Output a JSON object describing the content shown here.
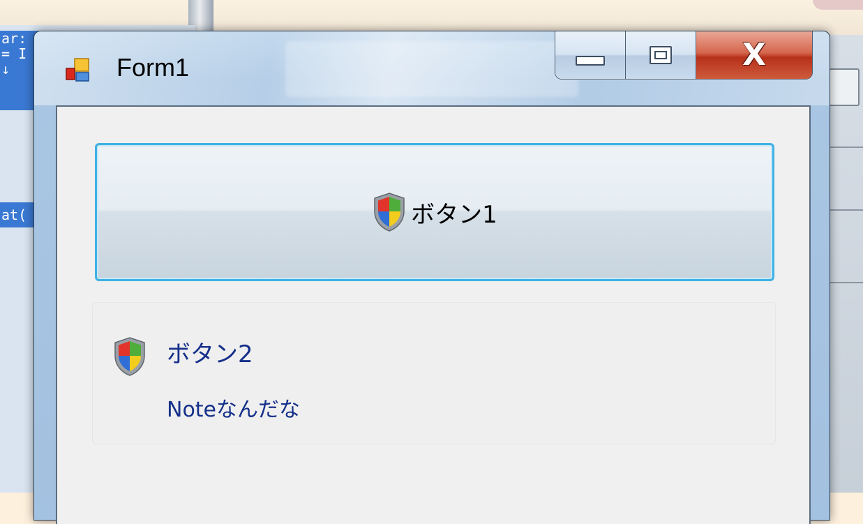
{
  "window": {
    "title": "Form1",
    "app_icon": "form-app-icon",
    "caption_buttons": {
      "minimize": "minimize-icon",
      "maximize": "maximize-icon",
      "close": "close-icon",
      "close_glyph": "X"
    }
  },
  "background": {
    "editor_fragments": [
      "ar:",
      "= I",
      "↓",
      "at("
    ]
  },
  "client": {
    "button1": {
      "label": "ボタン1",
      "icon": "uac-shield-icon"
    },
    "command_link": {
      "title": "ボタン2",
      "note": "Noteなんだな",
      "icon": "uac-shield-icon"
    }
  },
  "colors": {
    "focus_border": "#3fb1e4",
    "close_button": "#c9452b",
    "command_link_text": "#15308a"
  }
}
